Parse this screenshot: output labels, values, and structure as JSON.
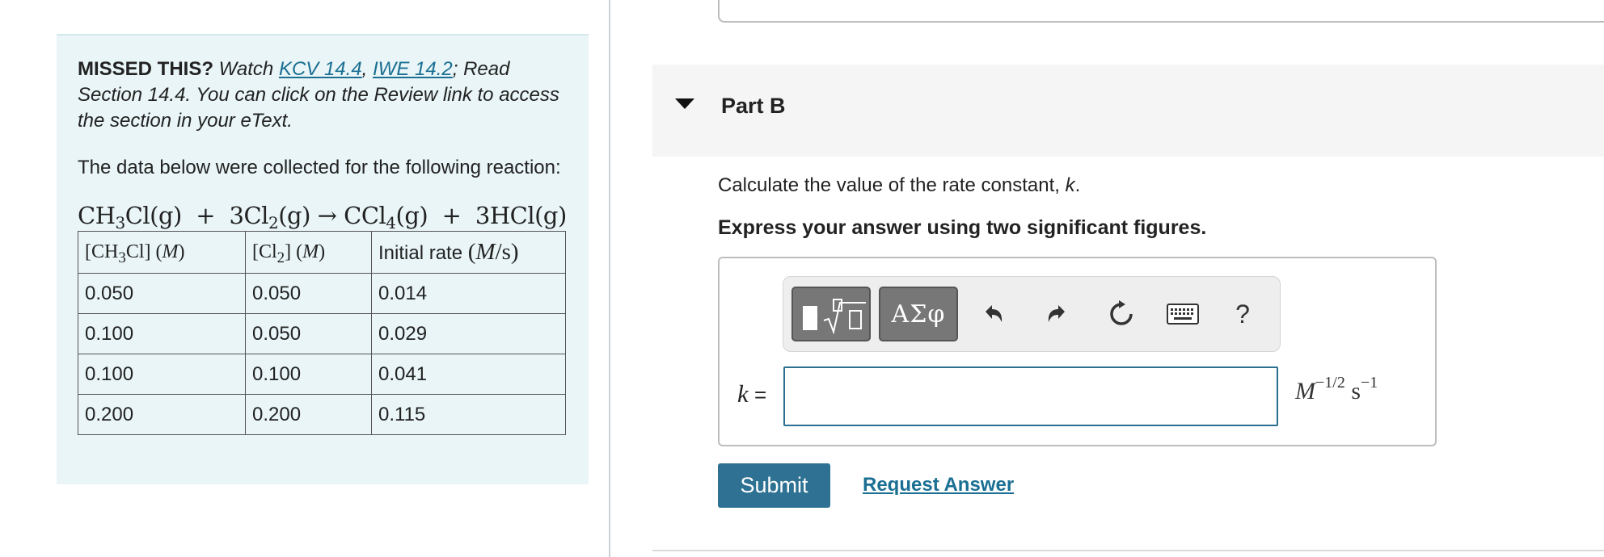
{
  "hint": {
    "missed_label": "MISSED THIS?",
    "watch_text": " Watch ",
    "link1": "KCV 14.4",
    "comma": ", ",
    "link2": "IWE 14.2",
    "read_text": "; Read Section 14.4. You can click on the Review link to access the section in your eText.",
    "intro": "The data below were collected for the following reaction:"
  },
  "equation": {
    "r1": "CH",
    "r1_sub": "3",
    "r1_tail": "Cl(g)  +  3Cl",
    "r2_sub": "2",
    "r2_tail": "(g) → CCl",
    "p1_sub": "4",
    "p1_tail": "(g)  +  3HCl(g)"
  },
  "table": {
    "headers": {
      "c1": {
        "a": "[CH",
        "sub": "3",
        "b": "Cl] (",
        "unit": "M",
        "c": ")"
      },
      "c2": {
        "a": "[Cl",
        "sub": "2",
        "b": "] (",
        "unit": "M",
        "c": ")"
      },
      "c3": {
        "text": "Initial rate ",
        "a": "(",
        "unit": "M",
        "b": "/s)"
      }
    },
    "rows": [
      [
        "0.050",
        "0.050",
        "0.014"
      ],
      [
        "0.100",
        "0.050",
        "0.029"
      ],
      [
        "0.100",
        "0.100",
        "0.041"
      ],
      [
        "0.200",
        "0.200",
        "0.115"
      ]
    ]
  },
  "part": {
    "title": "Part B",
    "question_prefix": "Calculate the value of the rate constant, ",
    "question_var": "k",
    "question_suffix": ".",
    "instruction": "Express your answer using two significant figures."
  },
  "toolbar": {
    "greek_label": "ΑΣφ",
    "help_label": "?"
  },
  "answer": {
    "var": "k",
    "equals": " =",
    "value": "",
    "unit_base": "M",
    "unit_exp": "−1/2",
    "unit_s": " s",
    "unit_s_exp": "−1"
  },
  "actions": {
    "submit_label": "Submit",
    "request_label": "Request Answer"
  },
  "colors": {
    "hint_bg": "#e9f5f7",
    "link": "#1a6f93",
    "submit_bg": "#2e7192",
    "input_border": "#2c6f93"
  }
}
